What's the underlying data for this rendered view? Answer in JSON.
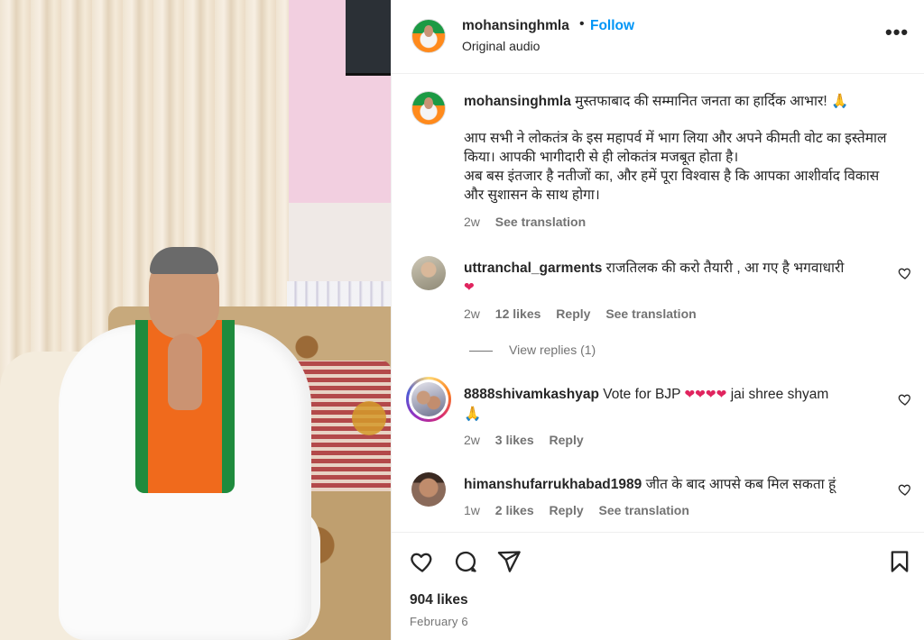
{
  "header": {
    "username": "mohansinghmla",
    "dot": "•",
    "follow_label": "Follow",
    "audio": "Original audio",
    "more": "•••"
  },
  "caption": {
    "username": "mohansinghmla",
    "first_line": "मुस्तफाबाद की सम्मानित जनता का हार्दिक आभार! 🙏",
    "body_1": "आप सभी ने लोकतंत्र के इस महापर्व में भाग लिया और अपने कीमती वोट का इस्तेमाल किया। आपकी भागीदारी से ही लोकतंत्र मजबूत होता है।",
    "body_2": "अब बस इंतजार है नतीजों का, और हमें पूरा विश्वास है कि आपका आशीर्वाद विकास और सुशासन के साथ होगा।",
    "time": "2w",
    "see_translation": "See translation"
  },
  "comments": [
    {
      "username": "uttranchal_garments",
      "text": "राजतिलक की करो तैयारी , आ गए है भगवाधारी",
      "emoji": "❤",
      "time": "2w",
      "likes": "12 likes",
      "reply": "Reply",
      "see_translation": "See translation",
      "view_replies": "View replies (1)"
    },
    {
      "username": "8888shivamkashyap",
      "text": "Vote for BJP",
      "emoji": "❤❤❤❤",
      "text_after": "jai shree shyam",
      "emoji_2": "🙏",
      "time": "2w",
      "likes": "3 likes",
      "reply": "Reply"
    },
    {
      "username": "himanshufarrukhabad1989",
      "text": "जीत के बाद आपसे कब मिल सकता हूं",
      "time": "1w",
      "likes": "2 likes",
      "reply": "Reply",
      "see_translation": "See translation"
    }
  ],
  "footer": {
    "likes": "904 likes",
    "date": "February 6"
  },
  "icons": {
    "like": "heart-outline-icon",
    "comment": "comment-icon",
    "share": "paper-plane-icon",
    "save": "bookmark-icon",
    "more": "more-horizontal-icon"
  },
  "colors": {
    "follow_blue": "#0095f6",
    "text_primary": "#262626",
    "text_secondary": "#737373",
    "heart_red": "#e0245e"
  }
}
